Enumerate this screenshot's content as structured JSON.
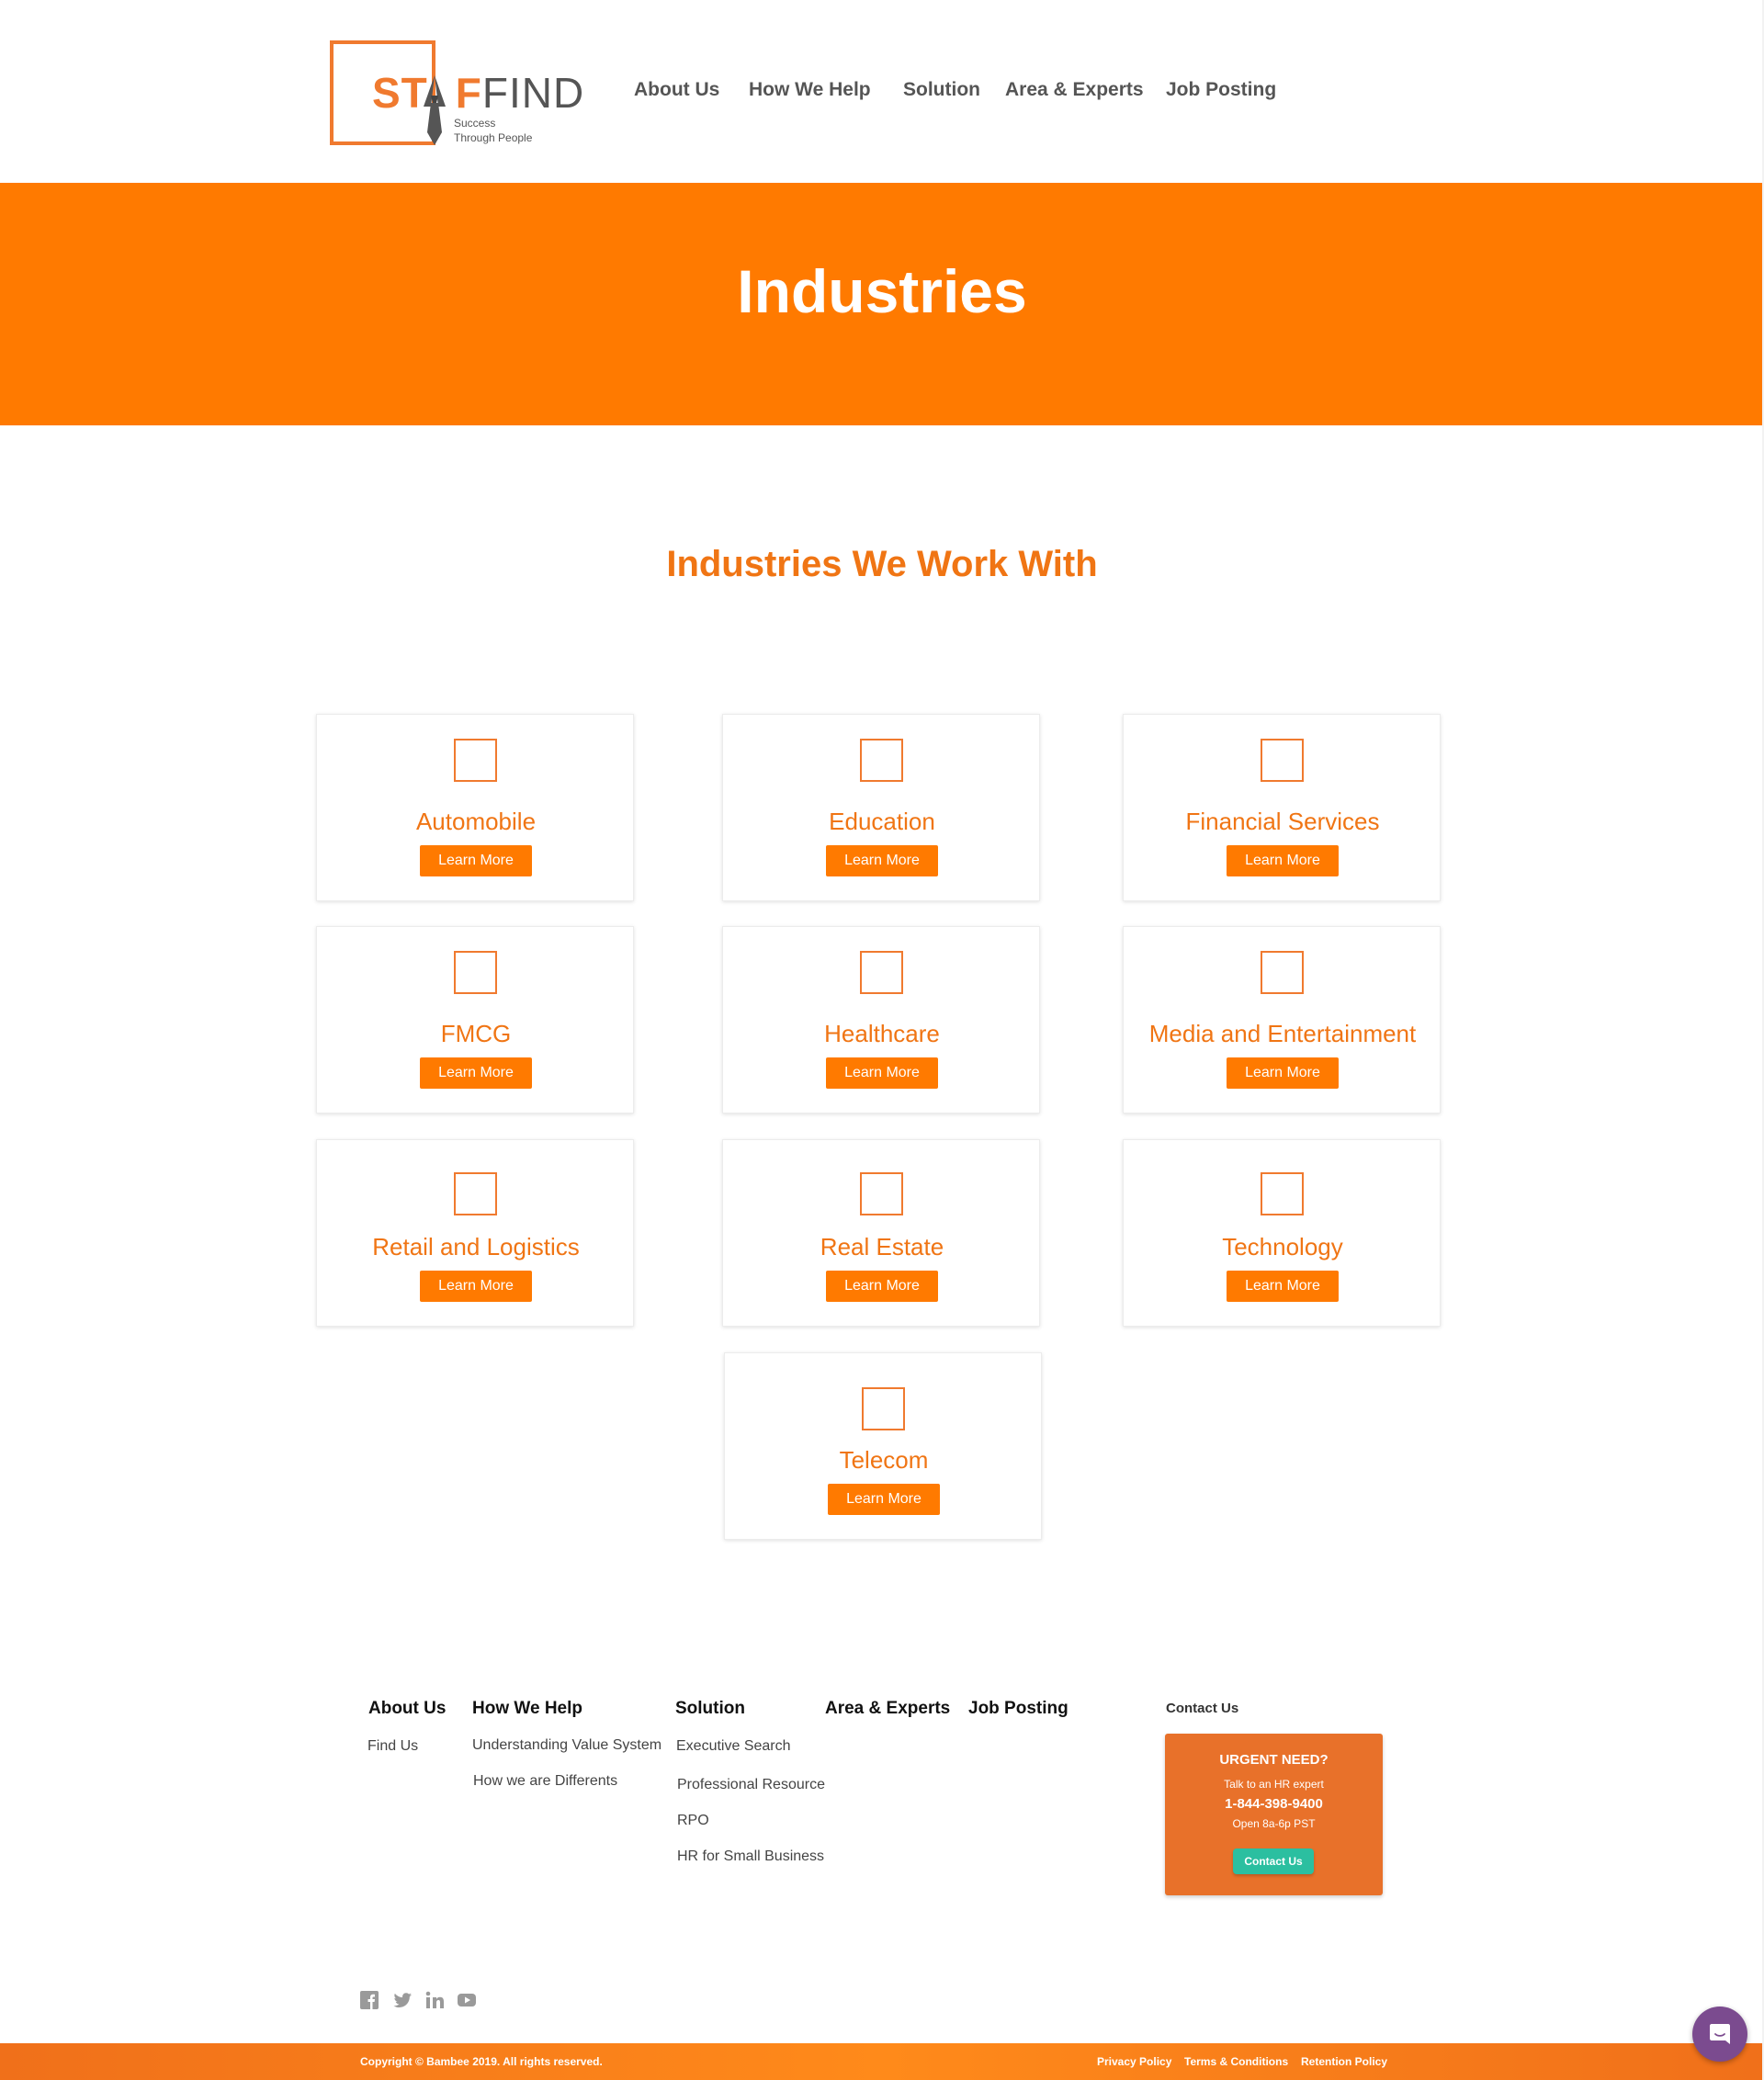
{
  "logo": {
    "word_orange_1": "ST",
    "word_orange_2": "F",
    "word_gray": "FIND",
    "tagline_1": "Success",
    "tagline_2": "Through People"
  },
  "nav": {
    "items": [
      "About Us",
      "How We Help",
      "Solution",
      "Area & Experts",
      "Job Posting"
    ]
  },
  "banner": {
    "title": "Industries"
  },
  "section": {
    "title": "Industries We Work With"
  },
  "industries": [
    {
      "name": "Automobile",
      "button": "Learn More"
    },
    {
      "name": "Education",
      "button": "Learn More"
    },
    {
      "name": "Financial Services",
      "button": "Learn More"
    },
    {
      "name": "FMCG",
      "button": "Learn More"
    },
    {
      "name": "Healthcare",
      "button": "Learn More"
    },
    {
      "name": "Media and Entertainment",
      "button": "Learn More"
    },
    {
      "name": "Retail and Logistics",
      "button": "Learn More"
    },
    {
      "name": "Real Estate",
      "button": "Learn More"
    },
    {
      "name": "Technology",
      "button": "Learn More"
    },
    {
      "name": "Telecom",
      "button": "Learn More"
    }
  ],
  "footer": {
    "columns": [
      {
        "heading": "About Us",
        "links": [
          "Find  Us"
        ]
      },
      {
        "heading": "How We Help",
        "links": [
          "Understanding Value System",
          "How we are Differents"
        ]
      },
      {
        "heading": "Solution",
        "links": [
          "Executive Search",
          "Professional Resource",
          "RPO",
          "HR for Small Business"
        ]
      },
      {
        "heading": "Area & Experts",
        "links": []
      },
      {
        "heading": "Job Posting",
        "links": []
      }
    ],
    "contact": {
      "heading": "Contact Us",
      "title": "URGENT NEED?",
      "subtitle": "Talk to an HR expert",
      "phone": "1-844-398-9400",
      "hours": "Open 8a-6p PST",
      "button": "Contact Us"
    },
    "social_icons": [
      "facebook-icon",
      "twitter-icon",
      "linkedin-icon",
      "youtube-icon"
    ],
    "copyright": "Copyright © Bambee 2019. All rights reserved.",
    "policies": [
      "Privacy Policy",
      "Terms & Conditions",
      "Retention Policy"
    ]
  },
  "colors": {
    "brand_orange": "#ff7a00",
    "title_orange": "#f07514",
    "contact_box": "#e8712a",
    "contact_button": "#2bbfa0",
    "chat_bubble": "#7b4b8f"
  }
}
